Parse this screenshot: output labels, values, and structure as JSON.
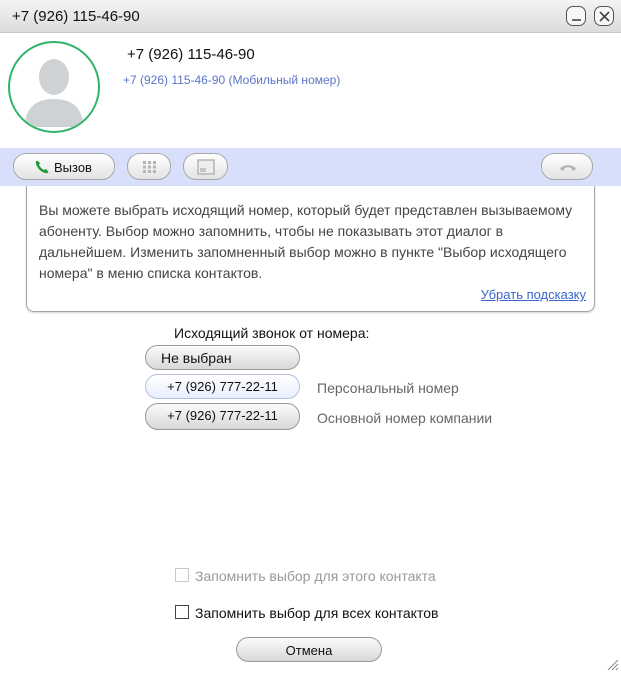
{
  "window": {
    "title": "+7 (926) 115-46-90",
    "minimize_icon": "minimize-icon",
    "close_icon": "close-icon"
  },
  "contact": {
    "name": "+7 (926) 115-46-90",
    "subtitle": "+7 (926) 115-46-90 (Мобильный номер)",
    "avatar_icon": "person-silhouette-icon",
    "avatar_ring_color": "#2fb56a"
  },
  "toolbar": {
    "call_label": "Вызов",
    "call_icon": "phone-icon",
    "keypad_icon": "keypad-icon",
    "screen_icon": "window-icon",
    "hangup_icon": "hangup-icon",
    "background_color": "#d8dffb"
  },
  "hint": {
    "text": "Вы можете выбрать исходящий номер, который будет представлен вызываемому абоненту. Выбор можно запомнить, чтобы не показывать этот диалог в дальнейшем. Изменить запомненный выбор можно в пункте \"Выбор исходящего номера\" в меню списка контактов.",
    "dismiss_link": "Убрать подсказку"
  },
  "outgoing": {
    "label": "Исходящий звонок от номера:",
    "none_option": "Не выбран",
    "options": [
      {
        "number": "+7 (926) 777-22-11",
        "description": "Персональный номер"
      },
      {
        "number": "+7 (926) 777-22-11",
        "description": "Основной номер компании"
      }
    ]
  },
  "remember": {
    "this_contact": {
      "label": "Запомнить выбор для этого контакта",
      "checked": false,
      "enabled": false
    },
    "all_contacts": {
      "label": "Запомнить выбор для всех контактов",
      "checked": false,
      "enabled": true
    }
  },
  "cancel_label": "Отмена"
}
